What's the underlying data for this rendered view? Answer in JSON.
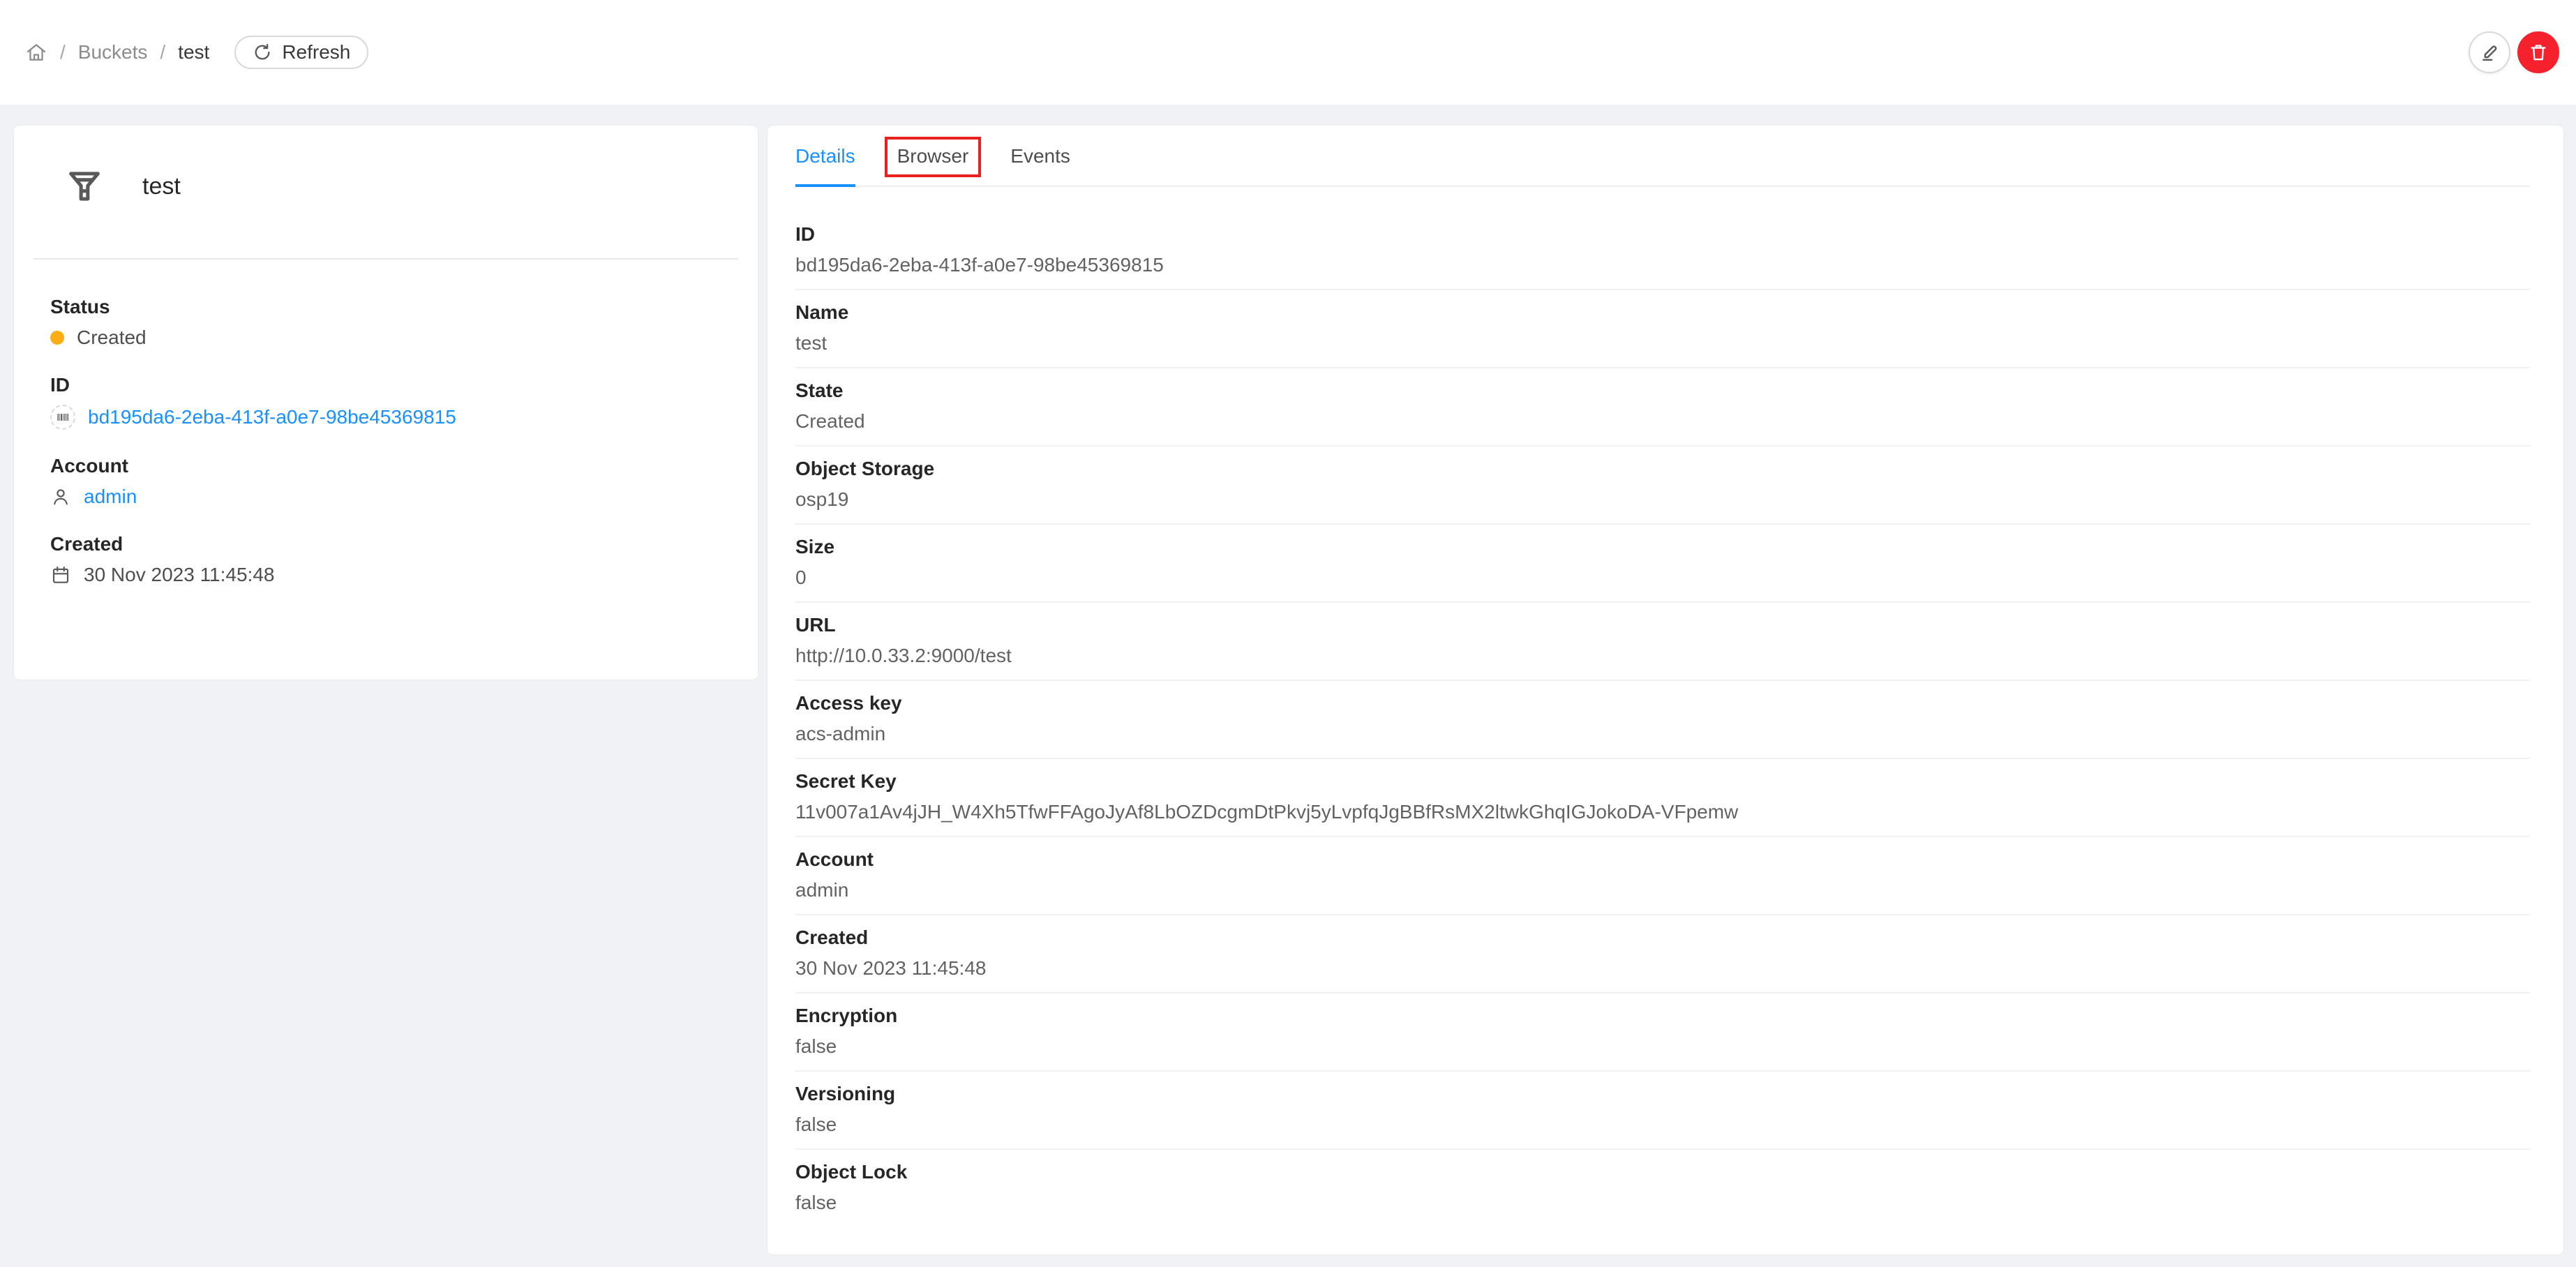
{
  "colors": {
    "accent": "#1890ff",
    "status_created": "#faad14",
    "danger": "#f5222d",
    "annotation": "#e8201e",
    "background": "#f0f2f5"
  },
  "header": {
    "breadcrumb": {
      "separator": "/",
      "items": [
        {
          "label": "Buckets"
        },
        {
          "label": "test"
        }
      ]
    },
    "refresh_label": "Refresh",
    "actions": [
      {
        "name": "edit",
        "icon": "pencil-icon"
      },
      {
        "name": "delete",
        "icon": "trash-icon"
      }
    ]
  },
  "info_panel": {
    "icon": "funnel-icon",
    "title": "test",
    "fields": [
      {
        "label": "Status",
        "value": "Created",
        "icon": "status-dot"
      },
      {
        "label": "ID",
        "value": "bd195da6-2eba-413f-a0e7-98be45369815",
        "icon": "barcode-icon",
        "link": true
      },
      {
        "label": "Account",
        "value": "admin",
        "icon": "user-icon",
        "link": true
      },
      {
        "label": "Created",
        "value": "30 Nov 2023 11:45:48",
        "icon": "calendar-icon"
      }
    ]
  },
  "tabs": [
    {
      "label": "Details",
      "active": true
    },
    {
      "label": "Browser",
      "annotated": true
    },
    {
      "label": "Events",
      "active": false
    }
  ],
  "details": {
    "rows": [
      {
        "label": "ID",
        "value": "bd195da6-2eba-413f-a0e7-98be45369815"
      },
      {
        "label": "Name",
        "value": "test"
      },
      {
        "label": "State",
        "value": "Created"
      },
      {
        "label": "Object Storage",
        "value": "osp19"
      },
      {
        "label": "Size",
        "value": "0"
      },
      {
        "label": "URL",
        "value": "http://10.0.33.2:9000/test"
      },
      {
        "label": "Access key",
        "value": "acs-admin"
      },
      {
        "label": "Secret Key",
        "value": "11v007a1Av4jJH_W4Xh5TfwFFAgoJyAf8LbOZDcgmDtPkvj5yLvpfqJgBBfRsMX2ltwkGhqIGJokoDA-VFpemw"
      },
      {
        "label": "Account",
        "value": "admin"
      },
      {
        "label": "Created",
        "value": "30 Nov 2023 11:45:48"
      },
      {
        "label": "Encryption",
        "value": "false"
      },
      {
        "label": "Versioning",
        "value": "false"
      },
      {
        "label": "Object Lock",
        "value": "false"
      }
    ]
  }
}
